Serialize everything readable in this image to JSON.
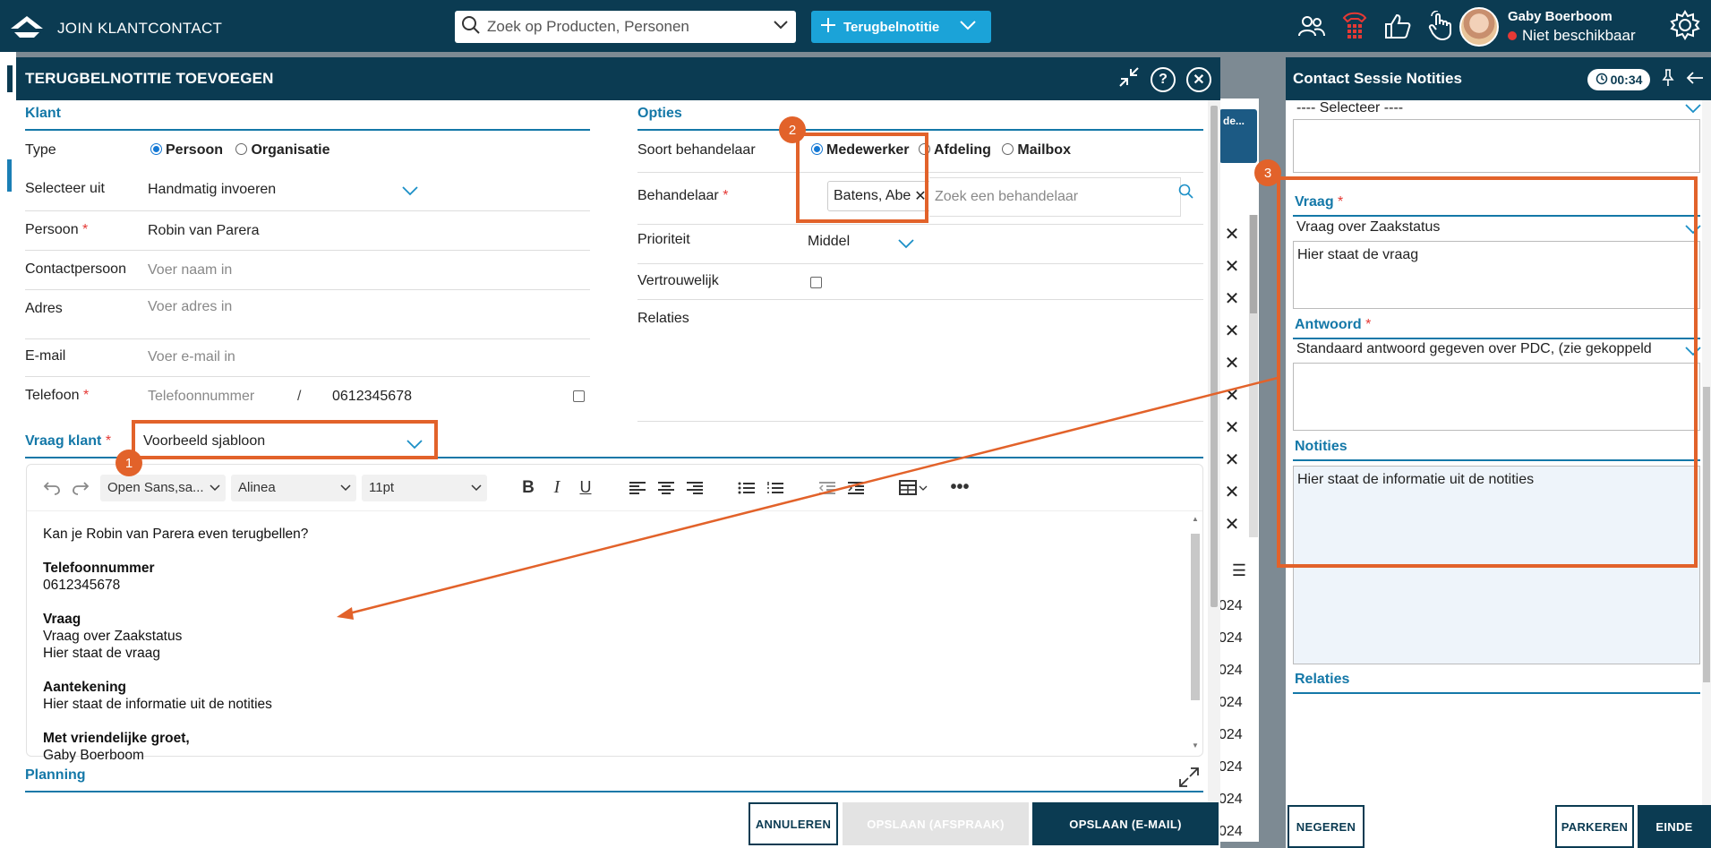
{
  "topbar": {
    "brand": "JOIN KLANTCONTACT",
    "search_placeholder": "Zoek op Producten, Personen",
    "new_button_label": "Terugbelnotitie",
    "user_name": "Gaby Boerboom",
    "user_status": "Niet beschikbaar",
    "status_color": "#e53935",
    "icons": [
      "contacts-icon",
      "phone-icon",
      "thumbs-up-icon",
      "hand-pointer-icon",
      "settings-icon"
    ]
  },
  "background": {
    "tile_label": "de...",
    "year_rows": [
      "024",
      "024",
      "024",
      "024",
      "024",
      "024",
      "024",
      "024"
    ]
  },
  "modal": {
    "title": "TERUGBELNOTITIE TOEVOEGEN",
    "klant": {
      "section_title": "Klant",
      "type_label": "Type",
      "type_options": [
        "Persoon",
        "Organisatie"
      ],
      "type_selected": "Persoon",
      "select_from_label": "Selecteer uit",
      "select_from_value": "Handmatig invoeren",
      "person_label": "Persoon",
      "person_value": "Robin van Parera",
      "contact_label": "Contactpersoon",
      "contact_placeholder": "Voer naam in",
      "address_label": "Adres",
      "address_placeholder": "Voer adres in",
      "email_label": "E-mail",
      "email_placeholder": "Voer e-mail in",
      "phone_label": "Telefoon",
      "phone_type_placeholder": "Telefoonnummer",
      "phone_separator": "/",
      "phone_value": "0612345678"
    },
    "opties": {
      "section_title": "Opties",
      "handler_type_label": "Soort behandelaar",
      "handler_type_options": [
        "Medewerker",
        "Afdeling",
        "Mailbox"
      ],
      "handler_type_selected": "Medewerker",
      "handler_label": "Behandelaar",
      "handler_tag": "Batens, Abe",
      "handler_placeholder": "Zoek een behandelaar",
      "priority_label": "Prioriteit",
      "priority_value": "Middel",
      "confidential_label": "Vertrouwelijk",
      "relations_label": "Relaties"
    },
    "question": {
      "label": "Vraag klant",
      "template_value": "Voorbeeld sjabloon"
    },
    "editor": {
      "font": "Open Sans,sa...",
      "paragraph": "Alinea",
      "size": "11pt",
      "body": [
        {
          "text": "Kan je Robin van Parera even terugbellen?",
          "bold": false
        },
        {
          "text": "",
          "bold": false
        },
        {
          "text": "Telefoonnummer",
          "bold": true
        },
        {
          "text": "0612345678",
          "bold": false
        },
        {
          "text": "",
          "bold": false
        },
        {
          "text": "Vraag",
          "bold": true
        },
        {
          "text": "Vraag over Zaakstatus",
          "bold": false
        },
        {
          "text": "Hier staat de vraag",
          "bold": false
        },
        {
          "text": "",
          "bold": false
        },
        {
          "text": "Aantekening",
          "bold": true
        },
        {
          "text": "Hier staat de informatie uit de notities",
          "bold": false
        },
        {
          "text": "",
          "bold": false
        },
        {
          "text": "Met vriendelijke groet,",
          "bold": true
        },
        {
          "text": "Gaby Boerboom",
          "bold": false
        }
      ]
    },
    "planning_title": "Planning",
    "buttons": {
      "cancel": "ANNULEREN",
      "save_appointment": "OPSLAAN (AFSPRAAK)",
      "save_email": "OPSLAAN (E-MAIL)"
    }
  },
  "right_panel": {
    "title": "Contact Sessie Notities",
    "timer": "00:34",
    "select_placeholder": "---- Selecteer ----",
    "question_label": "Vraag",
    "question_value": "Vraag over Zaakstatus",
    "question_text": "Hier staat de vraag",
    "answer_label": "Antwoord",
    "answer_value": "Standaard antwoord gegeven over PDC, (zie gekoppeld",
    "notes_label": "Notities",
    "notes_text": "Hier staat de informatie uit de notities",
    "relations_label": "Relaties",
    "buttons": {
      "ignore": "NEGEREN",
      "park": "PARKEREN",
      "end": "EINDE"
    }
  },
  "annotations": {
    "color": "#e2622a",
    "badges": [
      "1",
      "2",
      "3"
    ]
  }
}
